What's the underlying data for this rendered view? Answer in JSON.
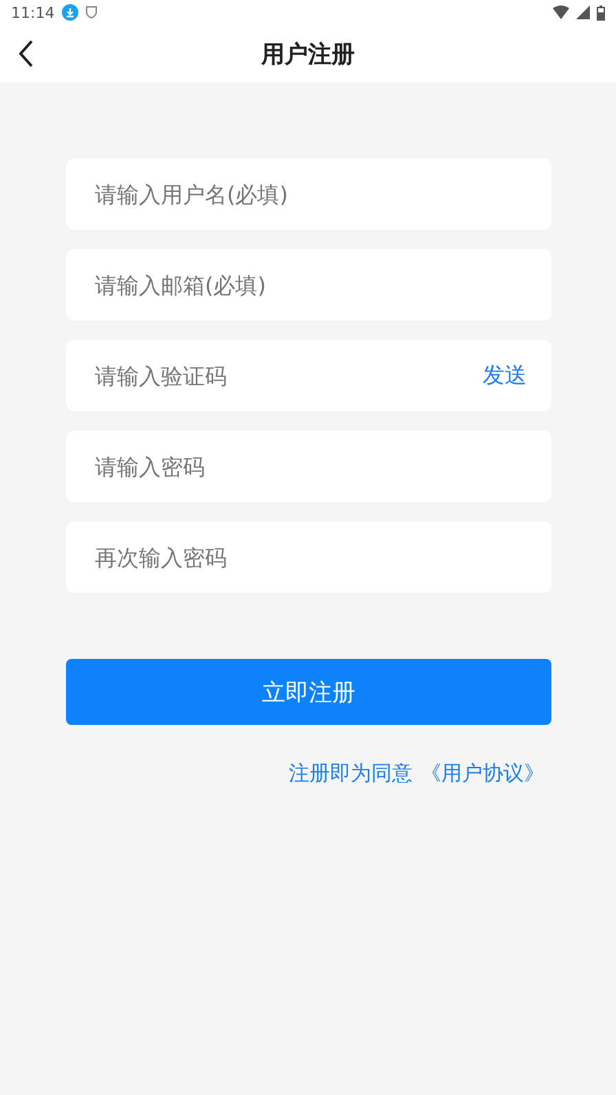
{
  "status_bar": {
    "time": "11:14"
  },
  "header": {
    "title": "用户注册"
  },
  "fields": [
    {
      "placeholder": "请输入用户名(必填)"
    },
    {
      "placeholder": "请输入邮箱(必填)"
    },
    {
      "placeholder": "请输入验证码",
      "action": "发送"
    },
    {
      "placeholder": "请输入密码"
    },
    {
      "placeholder": "再次输入密码"
    }
  ],
  "submit": "立即注册",
  "agreement": {
    "text": "注册即为同意",
    "link": "《用户协议》"
  }
}
